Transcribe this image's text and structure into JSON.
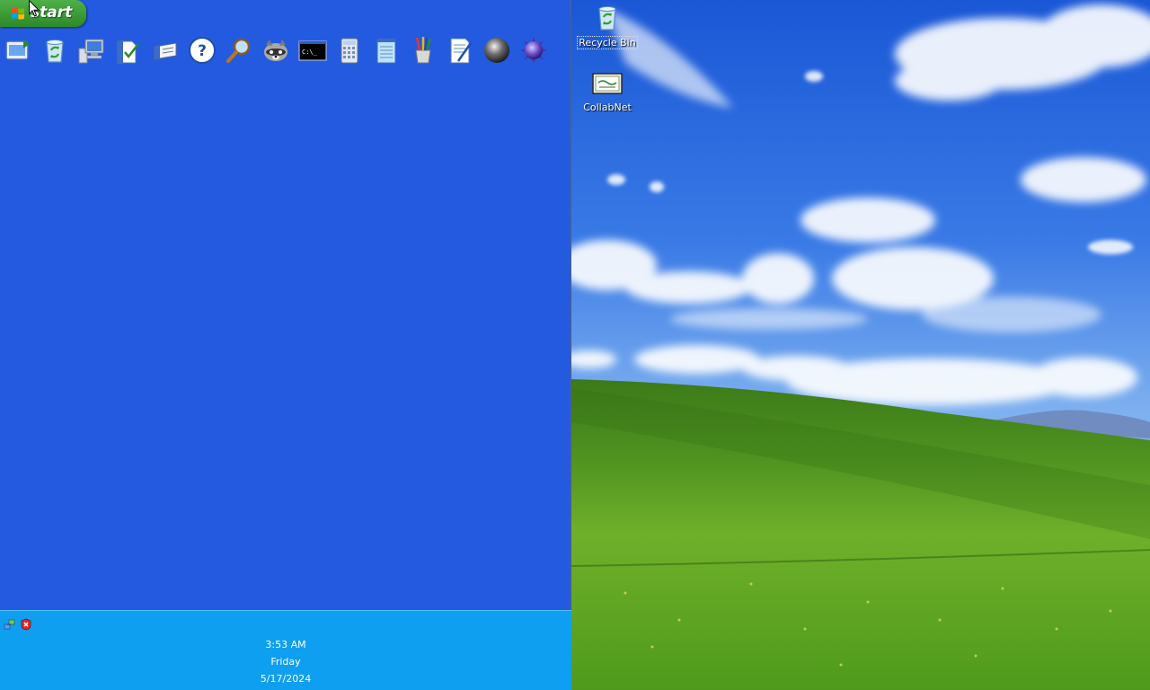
{
  "taskbar": {
    "start_label": "start",
    "quick_launch": [
      {
        "name": "show-desktop-icon"
      },
      {
        "name": "recycle-bin-icon"
      },
      {
        "name": "my-computer-icon"
      },
      {
        "name": "my-documents-icon"
      },
      {
        "name": "run-icon"
      },
      {
        "name": "help-icon"
      },
      {
        "name": "search-icon"
      },
      {
        "name": "raccoon-icon"
      },
      {
        "name": "command-prompt-icon"
      },
      {
        "name": "calculator-icon"
      },
      {
        "name": "notepad-icon"
      },
      {
        "name": "paint-icon"
      },
      {
        "name": "wordpad-icon"
      },
      {
        "name": "sphere-icon"
      },
      {
        "name": "spiky-ball-icon"
      }
    ]
  },
  "tray": {
    "time": "3:53 AM",
    "day": "Friday",
    "date": "5/17/2024"
  },
  "desktop": {
    "icons": [
      {
        "label": "Recycle Bin"
      },
      {
        "label": "CollabNet"
      }
    ]
  },
  "colors": {
    "taskbar_blue": "#245ae0",
    "tray_blue": "#0f9ff0",
    "start_green": "#3a9a35"
  }
}
